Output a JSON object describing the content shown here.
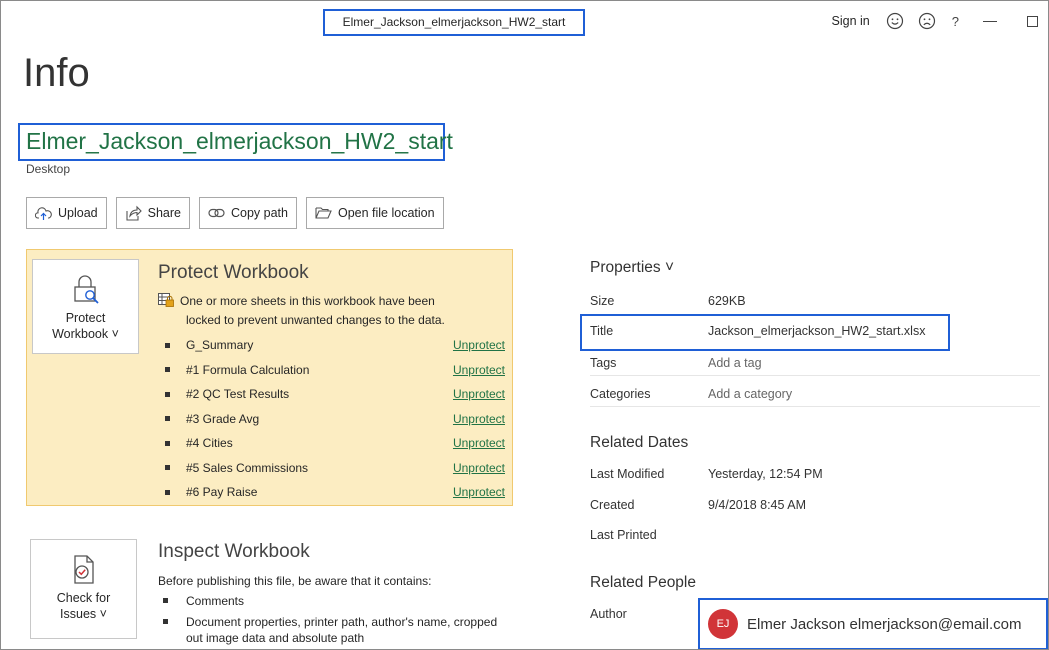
{
  "titlebar": {
    "doc_title": "Elmer_Jackson_elmerjackson_HW2_start",
    "sign_in": "Sign in",
    "smile_icon": "smile-icon",
    "frown_icon": "frown-icon",
    "help": "?"
  },
  "page": {
    "title": "Info",
    "file_name": "Elmer_Jackson_elmerjackson_HW2_start",
    "location": "Desktop"
  },
  "actions": [
    {
      "label": "Upload",
      "icon": "upload-icon"
    },
    {
      "label": "Share",
      "icon": "share-icon"
    },
    {
      "label": "Copy path",
      "icon": "link-icon"
    },
    {
      "label": "Open file location",
      "icon": "folder-icon"
    }
  ],
  "protect": {
    "button_line1": "Protect",
    "button_line2": "Workbook ˅",
    "title": "Protect Workbook",
    "desc_line1": "One or more sheets in this workbook have been",
    "desc_line2": "locked to prevent unwanted changes to the data.",
    "link_label": "Unprotect",
    "sheets": [
      "G_Summary",
      "#1 Formula Calculation",
      "#2 QC Test Results",
      "#3 Grade Avg",
      "#4 Cities",
      "#5 Sales Commissions",
      "#6 Pay Raise"
    ]
  },
  "inspect": {
    "button_line1": "Check for",
    "button_line2": "Issues ˅",
    "title": "Inspect Workbook",
    "desc": "Before publishing this file, be aware that it contains:",
    "items": [
      "Comments",
      "Document properties, printer path, author's name, cropped out image data and absolute path"
    ]
  },
  "properties": {
    "heading": "Properties ˅",
    "size_label": "Size",
    "size_value": "629KB",
    "title_label": "Title",
    "title_value": "Jackson_elmerjackson_HW2_start.xlsx",
    "tags_label": "Tags",
    "tags_placeholder": "Add a tag",
    "categories_label": "Categories",
    "categories_placeholder": "Add a category"
  },
  "dates": {
    "heading": "Related Dates",
    "modified_label": "Last Modified",
    "modified_value": "Yesterday, 12:54 PM",
    "created_label": "Created",
    "created_value": "9/4/2018 8:45 AM",
    "printed_label": "Last Printed"
  },
  "people": {
    "heading": "Related People",
    "author_label": "Author",
    "author_initials": "EJ",
    "author_name": "Elmer Jackson elmerjackson@email.com",
    "avatar_color": "#d13438"
  },
  "colors": {
    "accent": "#217346",
    "highlight_box": "#1f5fd6",
    "protect_bg": "#fcedc2"
  }
}
